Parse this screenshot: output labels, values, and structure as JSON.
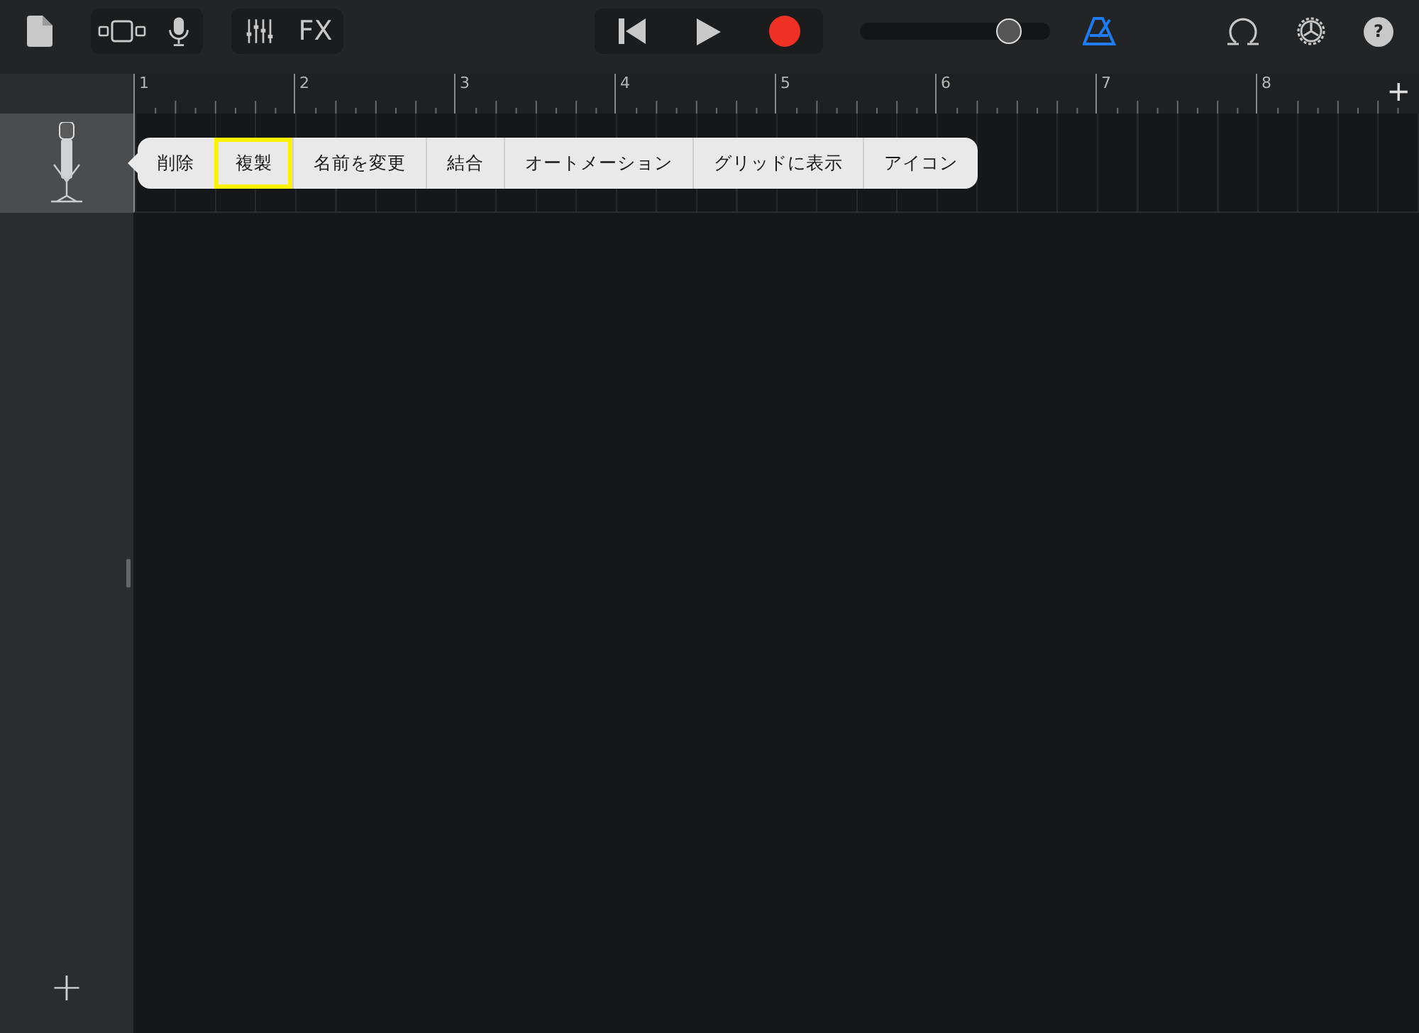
{
  "toolbar": {
    "fx_label": "FX",
    "metronome": {
      "on": true
    },
    "volume": {
      "level": 0.78
    },
    "help_label": "?"
  },
  "ruler": {
    "bars": [
      "1",
      "2",
      "3",
      "4",
      "5",
      "6",
      "7",
      "8"
    ],
    "add_label": "+"
  },
  "tracks": [
    {
      "selected": true
    }
  ],
  "context_menu": {
    "items": [
      {
        "label": "削除",
        "highlighted": false
      },
      {
        "label": "複製",
        "highlighted": true
      },
      {
        "label": "名前を変更",
        "highlighted": false
      },
      {
        "label": "結合",
        "highlighted": false
      },
      {
        "label": "オートメーション",
        "highlighted": false
      },
      {
        "label": "グリッドに表示",
        "highlighted": false
      },
      {
        "label": "アイコン",
        "highlighted": false
      }
    ]
  },
  "sidebar": {
    "add_label": "+"
  }
}
